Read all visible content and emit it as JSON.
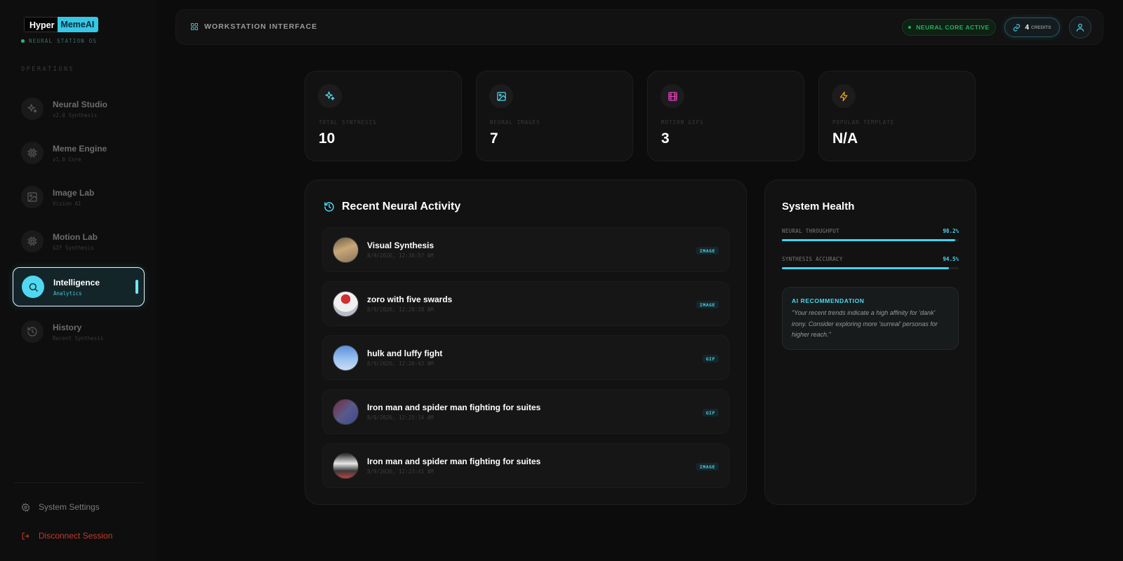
{
  "brand": {
    "part1": "Hyper",
    "part2": "MemeAI",
    "subtitle": "NEURAL STATION OS"
  },
  "sidebar": {
    "section_label": "OPERATIONS",
    "items": [
      {
        "title": "Neural Studio",
        "sub": "v2.0 Synthesis",
        "icon": "sparkles-icon"
      },
      {
        "title": "Meme Engine",
        "sub": "v1.0 Core",
        "icon": "cpu-icon"
      },
      {
        "title": "Image Lab",
        "sub": "Vision AI",
        "icon": "image-icon"
      },
      {
        "title": "Motion Lab",
        "sub": "GIF Synthesis",
        "icon": "cpu-icon"
      },
      {
        "title": "Intelligence",
        "sub": "Analytics",
        "icon": "search-icon",
        "active": true
      },
      {
        "title": "History",
        "sub": "Recent Synthesis",
        "icon": "history-icon"
      }
    ],
    "settings_label": "System Settings",
    "logout_label": "Disconnect Session"
  },
  "topbar": {
    "title": "WORKSTATION INTERFACE",
    "status": "NEURAL CORE ACTIVE",
    "credits_value": "4",
    "credits_label": "CREDITS"
  },
  "stats": [
    {
      "label": "TOTAL SYNTHESIS",
      "value": "10",
      "icon": "sparkles-icon",
      "color": "#4fd8f0"
    },
    {
      "label": "NEURAL IMAGES",
      "value": "7",
      "icon": "image-icon",
      "color": "#4fd8f0"
    },
    {
      "label": "MOTION GIFS",
      "value": "3",
      "icon": "film-icon",
      "color": "#e040c0"
    },
    {
      "label": "POPULAR TEMPLATE",
      "value": "N/A",
      "icon": "zap-icon",
      "color": "#f0a020"
    }
  ],
  "activity": {
    "title": "Recent Neural Activity",
    "rows": [
      {
        "title": "Visual Synthesis",
        "date": "8/9/2026, 12:30:57 AM",
        "badge": "IMAGE"
      },
      {
        "title": "zoro with five swards",
        "date": "8/9/2026, 12:28:20 AM",
        "badge": "IMAGE"
      },
      {
        "title": "hulk and luffy fight",
        "date": "8/9/2026, 12:26:43 AM",
        "badge": "GIF"
      },
      {
        "title": "Iron man and spider man fighting for suites",
        "date": "8/9/2026, 12:25:14 AM",
        "badge": "GIF"
      },
      {
        "title": "Iron man and spider man fighting for suites",
        "date": "8/9/2026, 12:23:41 AM",
        "badge": "IMAGE"
      }
    ]
  },
  "health": {
    "title": "System Health",
    "metrics": [
      {
        "label": "NEURAL THROUGHPUT",
        "value": "98.2%",
        "fraction": 0.982
      },
      {
        "label": "SYNTHESIS ACCURACY",
        "value": "94.5%",
        "fraction": 0.945
      }
    ],
    "rec_title": "AI RECOMMENDATION",
    "rec_text": "\"Your recent trends indicate a high affinity for 'dank' irony. Consider exploring more 'surreal' personas for higher reach.\""
  }
}
